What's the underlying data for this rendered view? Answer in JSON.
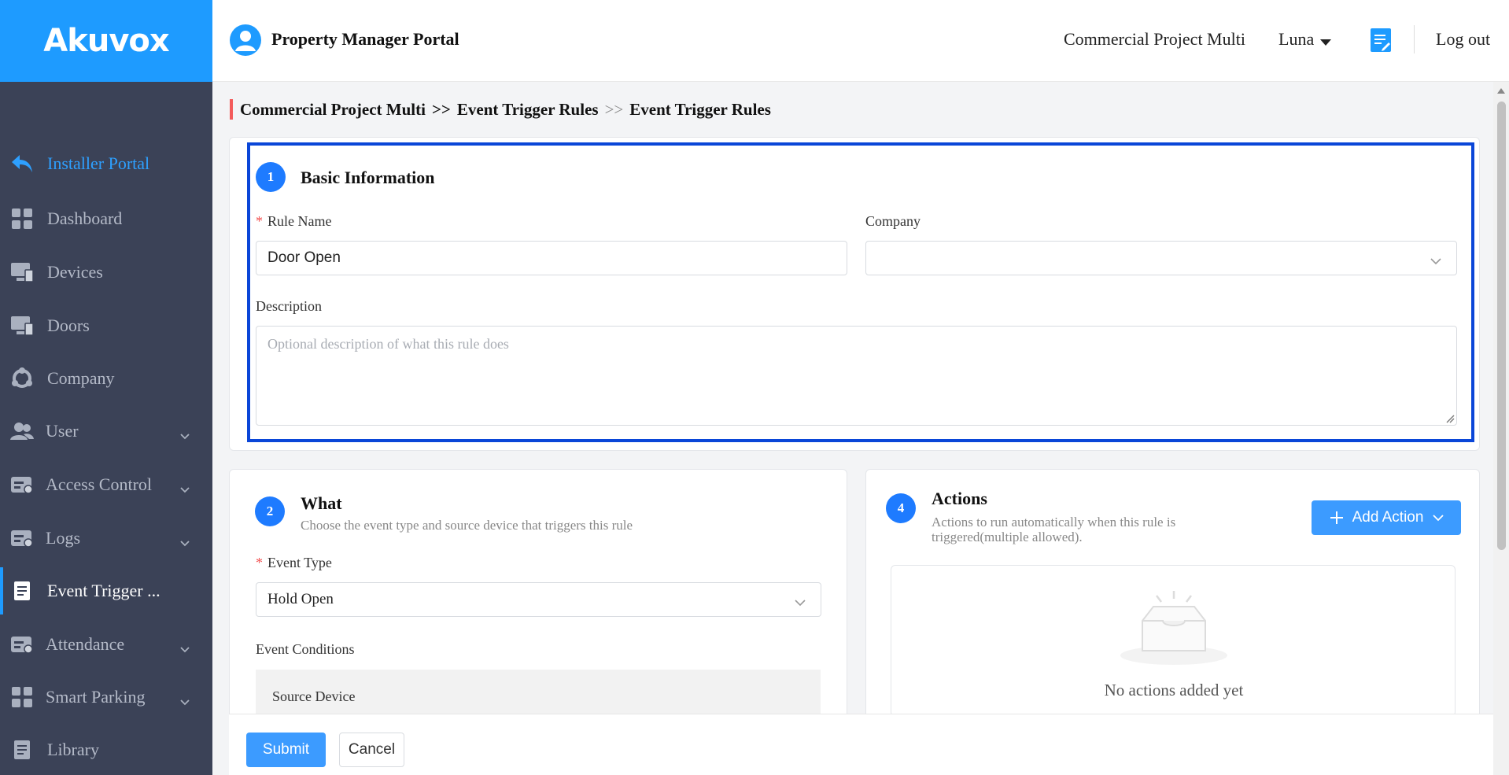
{
  "brand": {
    "logo_text": "Akuvox",
    "accent": "#1e9bff",
    "sidebar_bg": "#3b4257"
  },
  "header": {
    "title": "Property Manager Portal",
    "project": "Commercial Project Multi",
    "user": "Luna",
    "logout": "Log out",
    "avatar_icon": "user-avatar-icon",
    "doc_icon": "document-icon"
  },
  "sidebar": {
    "installer": "Installer Portal",
    "items": [
      {
        "label": "Dashboard",
        "icon": "grid-icon",
        "has_children": false
      },
      {
        "label": "Devices",
        "icon": "monitor-icon",
        "has_children": false
      },
      {
        "label": "Doors",
        "icon": "monitor-icon",
        "has_children": false
      },
      {
        "label": "Company",
        "icon": "company-icon",
        "has_children": false
      },
      {
        "label": "User",
        "icon": "users-icon",
        "has_children": true
      },
      {
        "label": "Access Control",
        "icon": "card-icon",
        "has_children": true
      },
      {
        "label": "Logs",
        "icon": "card-icon",
        "has_children": true
      },
      {
        "label": "Event Trigger ...",
        "icon": "document-icon",
        "has_children": false,
        "active": true
      },
      {
        "label": "Attendance",
        "icon": "card-icon",
        "has_children": true
      },
      {
        "label": "Smart Parking",
        "icon": "grid-icon",
        "has_children": true
      },
      {
        "label": "Library",
        "icon": "document-icon",
        "has_children": false
      }
    ]
  },
  "breadcrumb": {
    "part1": "Commercial Project Multi",
    "sep1": ">>",
    "part2": "Event Trigger Rules",
    "sep2": ">>",
    "part3": "Event Trigger Rules"
  },
  "basic": {
    "step": "1",
    "title": "Basic Information",
    "rule_name_label": "Rule Name",
    "rule_name_value": "Door Open",
    "company_label": "Company",
    "company_value": "",
    "description_label": "Description",
    "description_placeholder": "Optional description of what this rule does"
  },
  "what": {
    "step": "2",
    "title": "What",
    "subtitle": "Choose the event type and source device that triggers this rule",
    "event_type_label": "Event Type",
    "event_type_value": "Hold Open",
    "conditions_label": "Event Conditions",
    "source_device_label": "Source Device"
  },
  "actions": {
    "step": "4",
    "title": "Actions",
    "subtitle_line1": "Actions to run automatically when this rule is",
    "subtitle_line2": "triggered(multiple allowed).",
    "add_button": "Add Action",
    "empty_text": "No actions added yet"
  },
  "footer": {
    "submit": "Submit",
    "cancel": "Cancel"
  }
}
